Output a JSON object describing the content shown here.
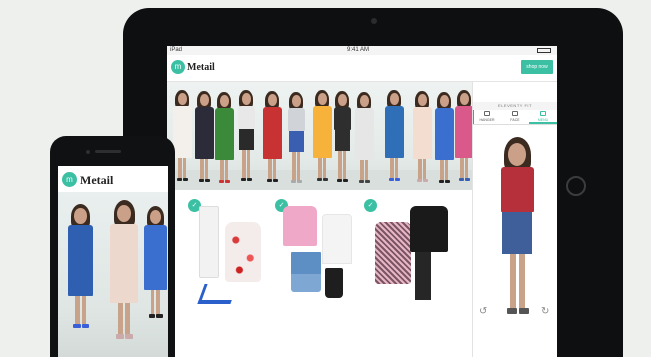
{
  "tablet": {
    "status": {
      "carrier": "iPad",
      "time": "9:41 AM"
    },
    "app": {
      "logo_text": "Metail",
      "logo_mark": "m",
      "header_button": "shop now"
    },
    "panel": {
      "title": "ELEVENTY FIT",
      "tabs": [
        {
          "label": "HANGER",
          "icon": "hanger-icon"
        },
        {
          "label": "FACE",
          "icon": "face-icon"
        },
        {
          "label": "MENU",
          "icon": "menu-icon"
        }
      ]
    },
    "product_badges": [
      "✓",
      "✓",
      "✓"
    ]
  },
  "phone": {
    "app": {
      "logo_text": "Metail",
      "logo_mark": "m"
    }
  },
  "colors": {
    "accent": "#3cc0a4",
    "device_frame": "#0e0f10",
    "background": "#eef0ee"
  }
}
